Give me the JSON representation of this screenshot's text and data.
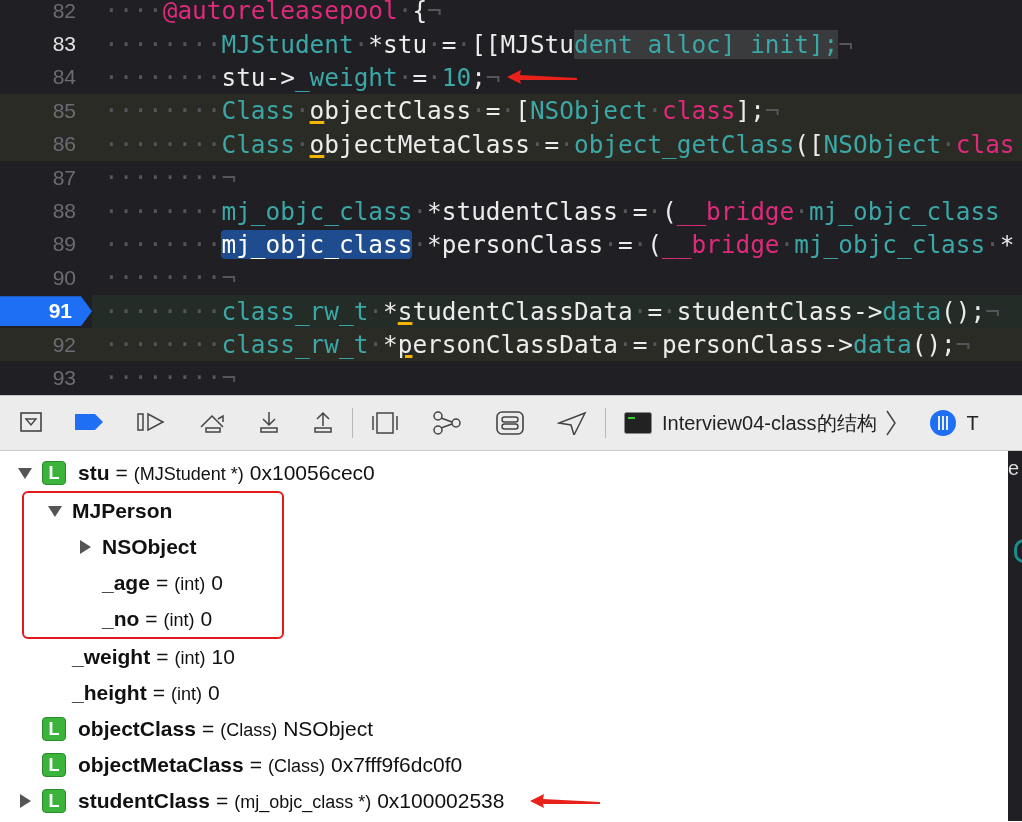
{
  "editor": {
    "lines": [
      {
        "number": "82",
        "kind": "plain",
        "current": false,
        "breakpoint": false,
        "arrow": false,
        "tokens": [
          {
            "t": "····",
            "kind": "ws"
          },
          {
            "t": "@autoreleasepool",
            "kind": "kw"
          },
          {
            "t": "·",
            "kind": "ws"
          },
          {
            "t": "{",
            "kind": "plain"
          },
          {
            "t": "¬",
            "kind": "ws"
          }
        ]
      },
      {
        "number": "83",
        "kind": "plain",
        "current": true,
        "breakpoint": false,
        "arrow": false,
        "tokens": [
          {
            "t": "········",
            "kind": "ws"
          },
          {
            "t": "MJStudent",
            "kind": "type"
          },
          {
            "t": "·",
            "kind": "ws"
          },
          {
            "t": "*stu",
            "kind": "plain"
          },
          {
            "t": "·",
            "kind": "ws"
          },
          {
            "t": "=",
            "kind": "plain"
          },
          {
            "t": "·",
            "kind": "ws"
          },
          {
            "t": "[[MJStu",
            "kind": "plain"
          },
          {
            "t": "dent alloc] init];",
            "kind": "find"
          },
          {
            "t": "¬",
            "kind": "ws"
          }
        ]
      },
      {
        "number": "84",
        "kind": "plain",
        "current": false,
        "breakpoint": false,
        "arrow": true,
        "tokens": [
          {
            "t": "········",
            "kind": "ws"
          },
          {
            "t": "stu->",
            "kind": "plain"
          },
          {
            "t": "_weight",
            "kind": "type"
          },
          {
            "t": "·",
            "kind": "ws"
          },
          {
            "t": "=",
            "kind": "plain"
          },
          {
            "t": "·",
            "kind": "ws"
          },
          {
            "t": "10",
            "kind": "type"
          },
          {
            "t": ";",
            "kind": "plain"
          },
          {
            "t": "¬",
            "kind": "ws"
          }
        ]
      },
      {
        "number": "85",
        "kind": "changed",
        "current": false,
        "breakpoint": false,
        "arrow": false,
        "tokens": [
          {
            "t": "········",
            "kind": "ws"
          },
          {
            "t": "Class",
            "kind": "type"
          },
          {
            "t": "·",
            "kind": "ws"
          },
          {
            "t": "o",
            "kind": "warn"
          },
          {
            "t": "bjectClass",
            "kind": "plain"
          },
          {
            "t": "·",
            "kind": "ws"
          },
          {
            "t": "=",
            "kind": "plain"
          },
          {
            "t": "·",
            "kind": "ws"
          },
          {
            "t": "[",
            "kind": "plain"
          },
          {
            "t": "NSObject",
            "kind": "type"
          },
          {
            "t": "·",
            "kind": "ws"
          },
          {
            "t": "class",
            "kind": "kw"
          },
          {
            "t": "];",
            "kind": "plain"
          },
          {
            "t": "¬",
            "kind": "ws"
          }
        ]
      },
      {
        "number": "86",
        "kind": "changed",
        "current": false,
        "breakpoint": false,
        "arrow": false,
        "tokens": [
          {
            "t": "········",
            "kind": "ws"
          },
          {
            "t": "Class",
            "kind": "type"
          },
          {
            "t": "·",
            "kind": "ws"
          },
          {
            "t": "o",
            "kind": "warn"
          },
          {
            "t": "bjectMetaClass",
            "kind": "plain"
          },
          {
            "t": "·",
            "kind": "ws"
          },
          {
            "t": "=",
            "kind": "plain"
          },
          {
            "t": "·",
            "kind": "ws"
          },
          {
            "t": "object_getClass",
            "kind": "type"
          },
          {
            "t": "([",
            "kind": "plain"
          },
          {
            "t": "NSObject",
            "kind": "type"
          },
          {
            "t": "·",
            "kind": "ws"
          },
          {
            "t": "clas",
            "kind": "kw"
          }
        ]
      },
      {
        "number": "87",
        "kind": "plain",
        "current": false,
        "breakpoint": false,
        "arrow": false,
        "tokens": [
          {
            "t": "········¬",
            "kind": "ws"
          }
        ]
      },
      {
        "number": "88",
        "kind": "plain",
        "current": false,
        "breakpoint": false,
        "arrow": false,
        "tokens": [
          {
            "t": "········",
            "kind": "ws"
          },
          {
            "t": "mj_objc_class",
            "kind": "type"
          },
          {
            "t": "·",
            "kind": "ws"
          },
          {
            "t": "*studentClass",
            "kind": "plain"
          },
          {
            "t": "·",
            "kind": "ws"
          },
          {
            "t": "=",
            "kind": "plain"
          },
          {
            "t": "·",
            "kind": "ws"
          },
          {
            "t": "(",
            "kind": "plain"
          },
          {
            "t": "__bridge",
            "kind": "kw"
          },
          {
            "t": "·",
            "kind": "ws"
          },
          {
            "t": "mj_objc_class",
            "kind": "type"
          }
        ]
      },
      {
        "number": "89",
        "kind": "plain",
        "current": false,
        "breakpoint": false,
        "arrow": false,
        "tokens": [
          {
            "t": "········",
            "kind": "ws"
          },
          {
            "t": "mj_objc_class",
            "kind": "sel"
          },
          {
            "t": "·",
            "kind": "ws"
          },
          {
            "t": "*personClass",
            "kind": "plain"
          },
          {
            "t": "·",
            "kind": "ws"
          },
          {
            "t": "=",
            "kind": "plain"
          },
          {
            "t": "·",
            "kind": "ws"
          },
          {
            "t": "(",
            "kind": "plain"
          },
          {
            "t": "__bridge",
            "kind": "kw"
          },
          {
            "t": "·",
            "kind": "ws"
          },
          {
            "t": "mj_objc_class",
            "kind": "type"
          },
          {
            "t": "·",
            "kind": "ws"
          },
          {
            "t": "*",
            "kind": "plain"
          }
        ]
      },
      {
        "number": "90",
        "kind": "plain",
        "current": false,
        "breakpoint": false,
        "arrow": false,
        "tokens": [
          {
            "t": "········¬",
            "kind": "ws"
          }
        ]
      },
      {
        "number": "91",
        "kind": "stopped",
        "current": false,
        "breakpoint": true,
        "arrow": false,
        "tokens": [
          {
            "t": "········",
            "kind": "ws"
          },
          {
            "t": "class_rw_t",
            "kind": "type"
          },
          {
            "t": "·",
            "kind": "ws"
          },
          {
            "t": "*",
            "kind": "plain"
          },
          {
            "t": "s",
            "kind": "warn"
          },
          {
            "t": "tudentClassData",
            "kind": "plain"
          },
          {
            "t": "·",
            "kind": "ws"
          },
          {
            "t": "=",
            "kind": "plain"
          },
          {
            "t": "·",
            "kind": "ws"
          },
          {
            "t": "studentClass->",
            "kind": "plain"
          },
          {
            "t": "data",
            "kind": "type"
          },
          {
            "t": "();",
            "kind": "plain"
          },
          {
            "t": "¬",
            "kind": "ws"
          }
        ]
      },
      {
        "number": "92",
        "kind": "changed",
        "current": false,
        "breakpoint": false,
        "arrow": false,
        "tokens": [
          {
            "t": "········",
            "kind": "ws"
          },
          {
            "t": "class_rw_t",
            "kind": "type"
          },
          {
            "t": "·",
            "kind": "ws"
          },
          {
            "t": "*",
            "kind": "plain"
          },
          {
            "t": "p",
            "kind": "warn"
          },
          {
            "t": "ersonClassData",
            "kind": "plain"
          },
          {
            "t": "·",
            "kind": "ws"
          },
          {
            "t": "=",
            "kind": "plain"
          },
          {
            "t": "·",
            "kind": "ws"
          },
          {
            "t": "personClass->",
            "kind": "plain"
          },
          {
            "t": "data",
            "kind": "type"
          },
          {
            "t": "();",
            "kind": "plain"
          },
          {
            "t": "¬",
            "kind": "ws"
          }
        ]
      },
      {
        "number": "93",
        "kind": "plain",
        "current": false,
        "breakpoint": false,
        "arrow": false,
        "tokens": [
          {
            "t": "········¬",
            "kind": "ws"
          }
        ]
      }
    ]
  },
  "debug_bar": {
    "tools": [
      {
        "kind": "hide"
      },
      {
        "kind": "breakpoints"
      },
      {
        "kind": "continue"
      },
      {
        "kind": "step-over"
      },
      {
        "kind": "step-into"
      },
      {
        "kind": "step-out"
      },
      {
        "kind": "divider"
      },
      {
        "kind": "view-debugger"
      },
      {
        "kind": "memory-graph"
      },
      {
        "kind": "environment"
      },
      {
        "kind": "location"
      },
      {
        "kind": "divider"
      }
    ],
    "target": "Interview04-class的结构",
    "thread": "T"
  },
  "variables": [
    {
      "name": "stu",
      "sign": "=",
      "type": "(MJStudent *)",
      "value": "0x10056cec0",
      "badge": "L",
      "expandable": true,
      "expanded": true,
      "outlined": false,
      "arrow": false,
      "children": [
        {
          "name": "MJPerson",
          "expandable": true,
          "expanded": true,
          "outlined": true,
          "arrow": false,
          "children": [
            {
              "name": "NSObject",
              "expandable": true,
              "expanded": false,
              "outlined": false,
              "arrow": false
            },
            {
              "name": "_age",
              "sign": "=",
              "type": "(int)",
              "value": "0",
              "expandable": false,
              "outlined": false,
              "arrow": false
            },
            {
              "name": "_no",
              "sign": "=",
              "type": "(int)",
              "value": "0",
              "expandable": false,
              "outlined": false,
              "arrow": false
            }
          ]
        },
        {
          "name": "_weight",
          "sign": "=",
          "type": "(int)",
          "value": "10",
          "expandable": false,
          "outlined": false,
          "arrow": false
        },
        {
          "name": "_height",
          "sign": "=",
          "type": "(int)",
          "value": "0",
          "expandable": false,
          "outlined": false,
          "arrow": false
        }
      ]
    },
    {
      "name": "objectClass",
      "sign": "=",
      "type": "(Class)",
      "value": "NSObject",
      "badge": "L",
      "expandable": false,
      "outlined": false,
      "arrow": false
    },
    {
      "name": "objectMetaClass",
      "sign": "=",
      "type": "(Class)",
      "value": "0x7fff9f6dc0f0",
      "badge": "L",
      "expandable": false,
      "outlined": false,
      "arrow": false
    },
    {
      "name": "studentClass",
      "sign": "=",
      "type": "(mj_objc_class *)",
      "value": "0x100002538",
      "badge": "L",
      "expandable": true,
      "expanded": false,
      "outlined": false,
      "arrow": true
    }
  ],
  "console": {
    "text": "e"
  }
}
